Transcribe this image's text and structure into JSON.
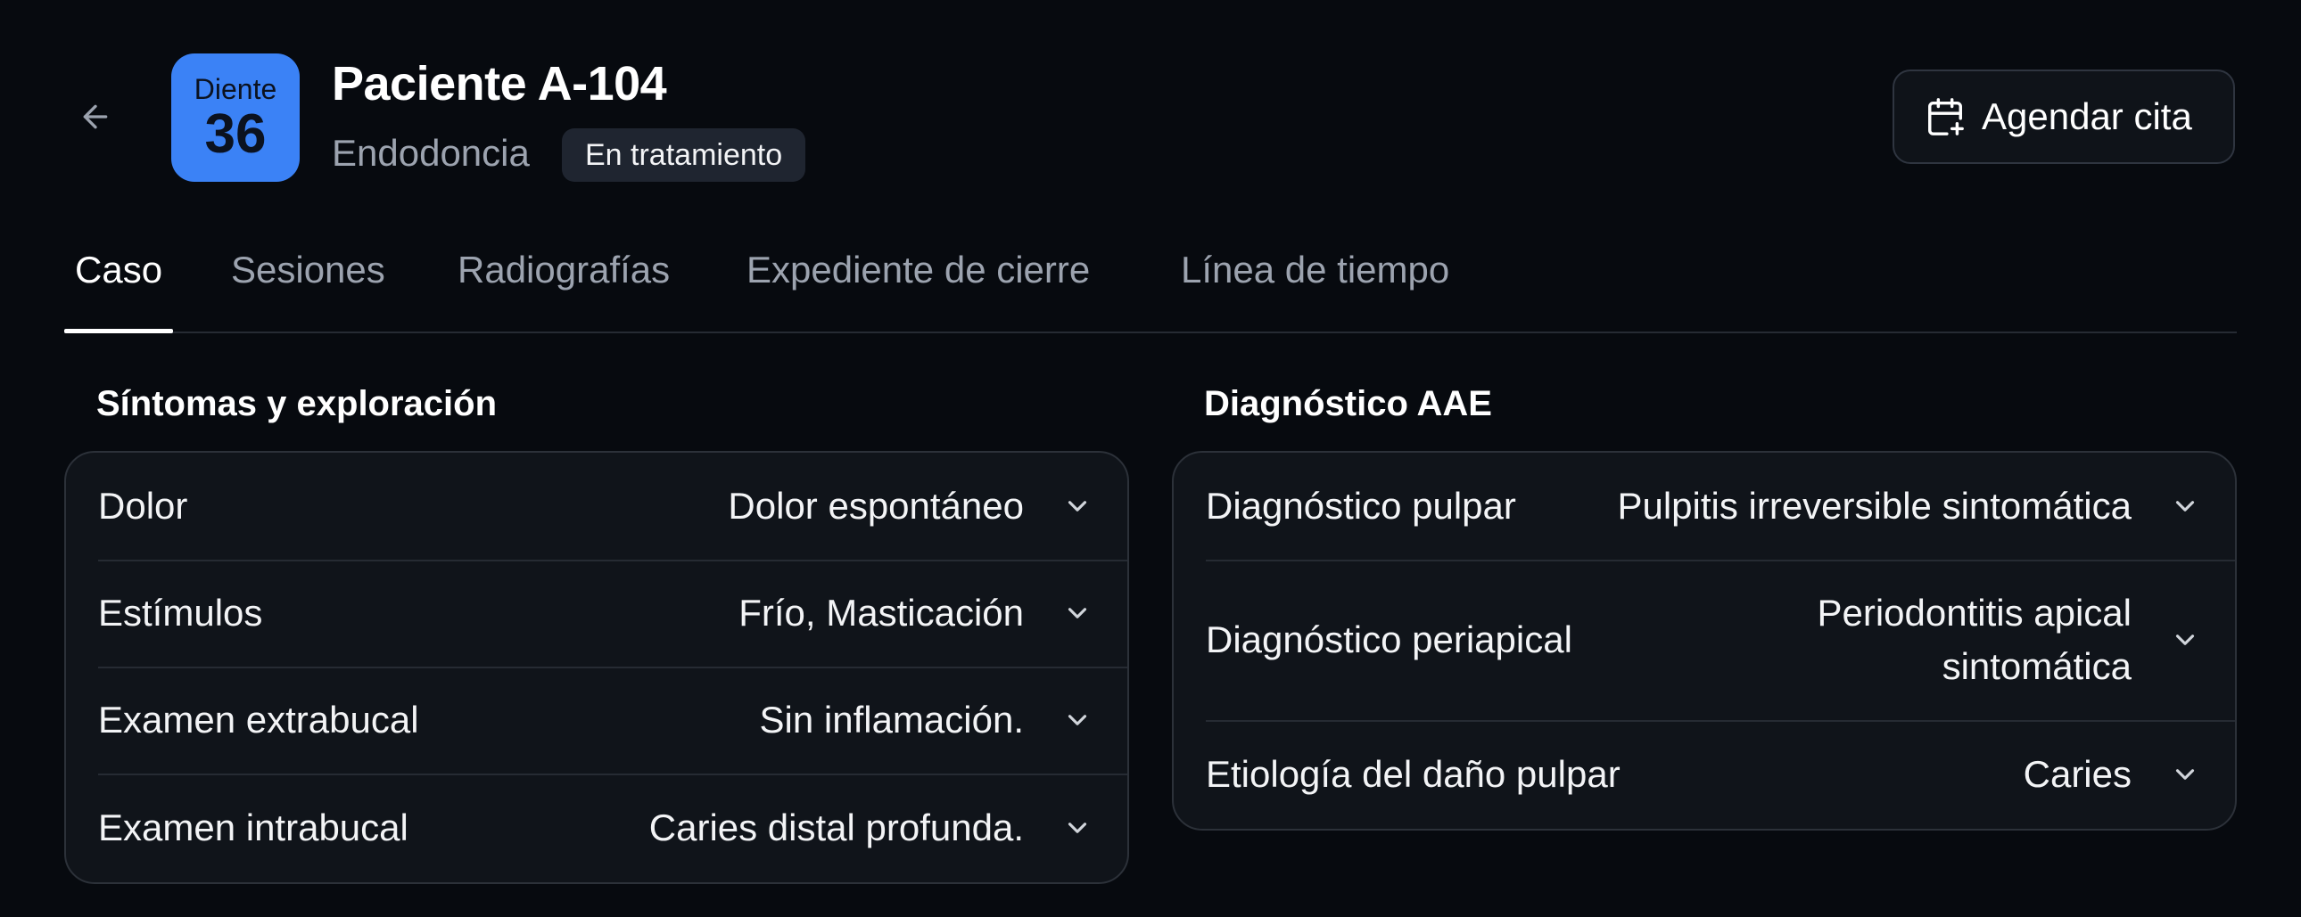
{
  "header": {
    "back_icon": "arrow-left-icon",
    "tooth_label": "Diente",
    "tooth_number": "36",
    "tooth_color": "#3b82f6",
    "title": "Paciente A-104",
    "specialty": "Endodoncia",
    "status": "En tratamiento",
    "schedule_button": {
      "icon": "calendar-plus-icon",
      "label": "Agendar cita"
    }
  },
  "tabs": [
    {
      "label": "Caso",
      "active": true
    },
    {
      "label": "Sesiones",
      "active": false
    },
    {
      "label": "Radiografías",
      "active": false
    },
    {
      "label": "Expediente de cierre",
      "active": false
    },
    {
      "label": "Línea de tiempo",
      "active": false
    }
  ],
  "symptoms": {
    "title": "Síntomas y exploración",
    "rows": [
      {
        "label": "Dolor",
        "value": "Dolor espontáneo",
        "icon": "chevron-down-icon"
      },
      {
        "label": "Estímulos",
        "value": "Frío, Masticación",
        "icon": "chevron-down-icon"
      },
      {
        "label": "Examen extrabucal",
        "value": "Sin inflamación.",
        "icon": "chevron-down-icon"
      },
      {
        "label": "Examen intrabucal",
        "value": "Caries distal profunda.",
        "icon": "chevron-down-icon"
      }
    ]
  },
  "diagnosis": {
    "title": "Diagnóstico AAE",
    "rows": [
      {
        "label": "Diagnóstico pulpar",
        "value": "Pulpitis irreversible sintomática",
        "icon": "chevron-down-icon"
      },
      {
        "label": "Diagnóstico periapical",
        "value": "Periodontitis apical sintomática",
        "icon": "chevron-down-icon"
      },
      {
        "label": "Etiología del daño pulpar",
        "value": "Caries",
        "icon": "chevron-down-icon"
      }
    ]
  }
}
